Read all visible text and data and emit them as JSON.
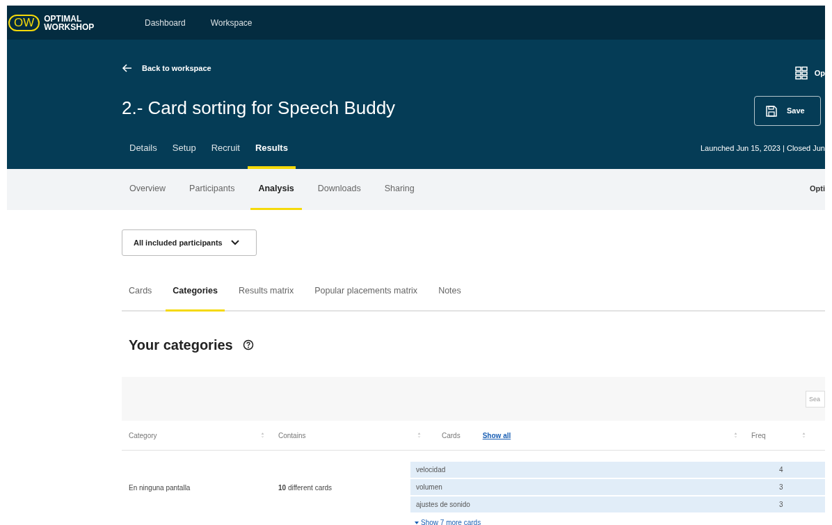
{
  "logo": {
    "mark": "OW",
    "name_lines": [
      "OPTIMAL",
      "WORKSHOP"
    ]
  },
  "top_nav": [
    {
      "label": "Dashboard"
    },
    {
      "label": "Workspace"
    }
  ],
  "back_link": "Back to workspace",
  "title": "2.- Card sorting for Speech Buddy",
  "options_label": "Op",
  "save_button": "Save",
  "study_status": "Launched Jun 15, 2023 | Closed Jun",
  "project_tabs": [
    {
      "label": "Details",
      "selected": false
    },
    {
      "label": "Setup",
      "selected": false
    },
    {
      "label": "Recruit",
      "selected": false
    },
    {
      "label": "Results",
      "selected": true
    }
  ],
  "results_tabs": [
    {
      "label": "Overview",
      "selected": false
    },
    {
      "label": "Participants",
      "selected": false
    },
    {
      "label": "Analysis",
      "selected": true
    },
    {
      "label": "Downloads",
      "selected": false
    },
    {
      "label": "Sharing",
      "selected": false
    }
  ],
  "results_right_label": "Opti",
  "participant_filter": "All included participants",
  "analysis_tabs": [
    {
      "label": "Cards",
      "selected": false
    },
    {
      "label": "Categories",
      "selected": true
    },
    {
      "label": "Results matrix",
      "selected": false
    },
    {
      "label": "Popular placements matrix",
      "selected": false
    },
    {
      "label": "Notes",
      "selected": false
    }
  ],
  "section_heading": "Your categories",
  "table": {
    "search_placeholder": "Sea",
    "columns": {
      "category": "Category",
      "contains": "Contains",
      "cards": "Cards",
      "show_all": "Show all",
      "freq": "Freq"
    },
    "rows": [
      {
        "category": "En ninguna pantalla",
        "contains": "**10** different cards",
        "cards": [
          {
            "name": "velocidad",
            "freq": "4"
          },
          {
            "name": "volumen",
            "freq": "3"
          },
          {
            "name": "ajustes de sonido",
            "freq": "3"
          }
        ],
        "show_more": "Show 7 more cards"
      }
    ]
  }
}
